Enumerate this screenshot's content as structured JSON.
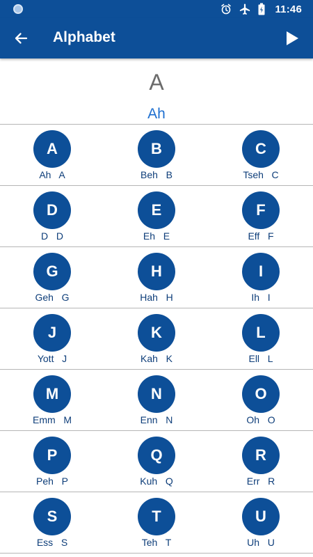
{
  "status_bar": {
    "time": "11:46",
    "icons": [
      "notification-dot-icon",
      "alarm-icon",
      "airplane-mode-icon",
      "battery-icon"
    ]
  },
  "app_bar": {
    "title": "Alphabet",
    "back_icon": "arrow-left-icon",
    "play_icon": "play-icon"
  },
  "focus": {
    "letter": "A",
    "pronunciation": "Ah"
  },
  "colors": {
    "primary": "#0d4f98",
    "accent_text": "#1e6fd0",
    "caption_text": "#0d3d79",
    "divider": "#b5b5b5"
  },
  "rows": [
    [
      {
        "letter": "A",
        "caption": "Ah   A"
      },
      {
        "letter": "B",
        "caption": "Beh   B"
      },
      {
        "letter": "C",
        "caption": "Tseh   C"
      }
    ],
    [
      {
        "letter": "D",
        "caption": "D   D"
      },
      {
        "letter": "E",
        "caption": "Eh   E"
      },
      {
        "letter": "F",
        "caption": "Eff   F"
      }
    ],
    [
      {
        "letter": "G",
        "caption": "Geh   G"
      },
      {
        "letter": "H",
        "caption": "Hah   H"
      },
      {
        "letter": "I",
        "caption": "Ih   I"
      }
    ],
    [
      {
        "letter": "J",
        "caption": "Yott   J"
      },
      {
        "letter": "K",
        "caption": "Kah   K"
      },
      {
        "letter": "L",
        "caption": "Ell   L"
      }
    ],
    [
      {
        "letter": "M",
        "caption": "Emm   M"
      },
      {
        "letter": "N",
        "caption": "Enn   N"
      },
      {
        "letter": "O",
        "caption": "Oh   O"
      }
    ],
    [
      {
        "letter": "P",
        "caption": "Peh   P"
      },
      {
        "letter": "Q",
        "caption": "Kuh   Q"
      },
      {
        "letter": "R",
        "caption": "Err   R"
      }
    ],
    [
      {
        "letter": "S",
        "caption": "Ess   S"
      },
      {
        "letter": "T",
        "caption": "Teh   T"
      },
      {
        "letter": "U",
        "caption": "Uh   U"
      }
    ]
  ]
}
